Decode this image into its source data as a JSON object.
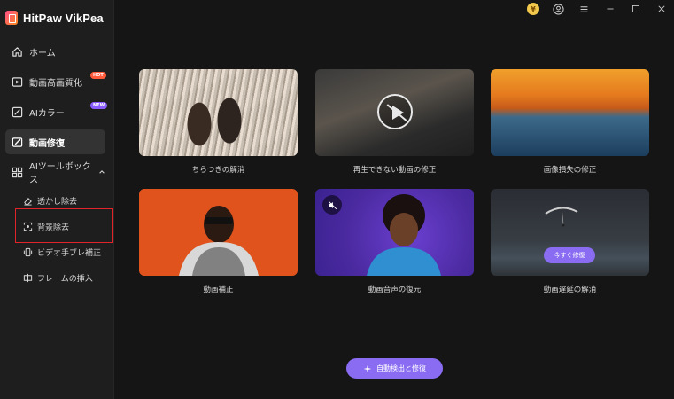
{
  "app": {
    "name": "HitPaw VikPea"
  },
  "sidebar": {
    "items": [
      {
        "label": "ホーム",
        "icon": "home-icon"
      },
      {
        "label": "動画高画質化",
        "icon": "video-enhance-icon",
        "badge": "HOT"
      },
      {
        "label": "AIカラー",
        "icon": "ai-color-icon",
        "badge": "NEW"
      },
      {
        "label": "動画修復",
        "icon": "video-repair-icon",
        "active": true
      },
      {
        "label": "AIツールボックス",
        "icon": "ai-toolbox-icon"
      }
    ],
    "sub_items": [
      {
        "label": "透かし除去",
        "icon": "eraser-icon"
      },
      {
        "label": "背景除去",
        "icon": "background-remove-icon"
      },
      {
        "label": "ビデオ手ブレ補正",
        "icon": "stabilize-icon"
      },
      {
        "label": "フレームの挿入",
        "icon": "frame-insert-icon"
      }
    ]
  },
  "topbar": {
    "coin_symbol": "¥"
  },
  "cards": [
    {
      "label": "ちらつきの解消"
    },
    {
      "label": "再生できない動画の修正"
    },
    {
      "label": "画像損失の修正"
    },
    {
      "label": "動画補正"
    },
    {
      "label": "動画音声の復元"
    },
    {
      "label": "動画遅延の解消",
      "button": "今すぐ修復"
    }
  ],
  "auto_button": {
    "label": "自動検出と修復"
  },
  "colors": {
    "accent": "#8a6cf2",
    "highlight": "#e0242a",
    "hot": "#ff5a3c",
    "new": "#8a5cff"
  }
}
